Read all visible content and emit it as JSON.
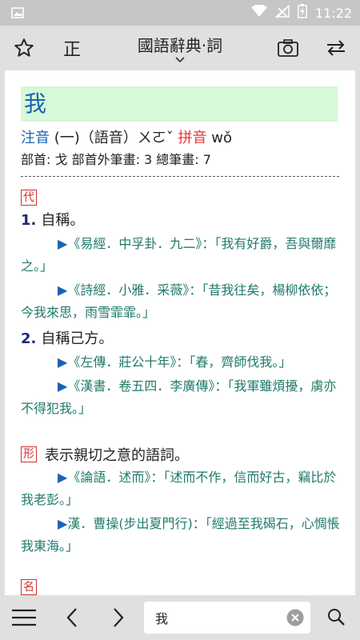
{
  "status": {
    "time": "11:22"
  },
  "toolbar": {
    "zheng": "正",
    "title": "國語辭典·詞"
  },
  "entry": {
    "headword": "我",
    "zhuyin_label": "注音",
    "zhuyin_value": "(一)（語音）ㄨㄛˇ",
    "pinyin_label": "拼音",
    "pinyin_value": "wǒ",
    "radical": "部首: 戈  部首外筆畫: 3  總筆畫: 7"
  },
  "sections": {
    "pos1": "代",
    "s1_num": "1.",
    "s1_text": "自稱。",
    "s1_q1": "《易經．中孚卦．九二》：「我有好爵，吾與爾靡之。」",
    "s1_q2": "《詩經．小雅．采薇》：「昔我往矣，楊柳依依；今我來思，雨雪霏霏。」",
    "s2_num": "2.",
    "s2_text": "自稱己方。",
    "s2_q1": "《左傳．莊公十年》：「春，齊師伐我。」",
    "s2_q2": "《漢書．卷五四．李廣傳》：「我軍雖煩擾，虜亦不得犯我。」",
    "pos2": "形",
    "pos2_text": "表示親切之意的語詞。",
    "p2_q1": "《論語．述而》：「述而不作，信而好古，竊比於我老彭。」",
    "p2_q2": "漢．曹操(步出夏門行)：「經過至我碣石，心惆悵我東海。」",
    "pos3": "名"
  },
  "search": {
    "value": "我"
  },
  "colors": {
    "accent": "#1a63b4",
    "pos_red": "#d32f2f",
    "quote_teal": "#1f7a6a",
    "headword_bg": "#d7f9d7"
  }
}
